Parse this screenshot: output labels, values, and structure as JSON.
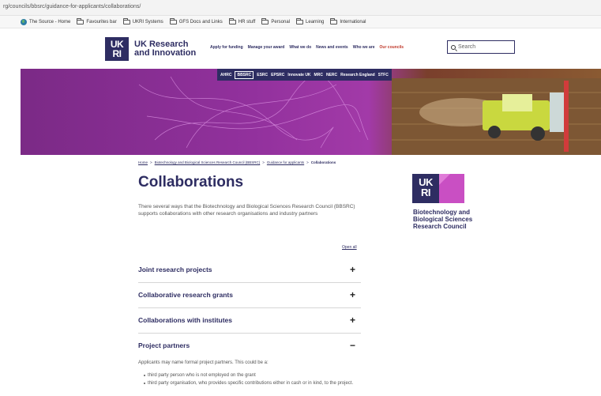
{
  "browser": {
    "url": "rg/councils/bbsrc/guidance-for-applicants/collaborations/",
    "bookmarks": [
      {
        "label": "The Source - Home",
        "icon": "globe-icon"
      },
      {
        "label": "Favourites bar",
        "icon": "folder-icon"
      },
      {
        "label": "UKRI Systems",
        "icon": "folder-icon"
      },
      {
        "label": "GFS Docs and Links",
        "icon": "folder-icon"
      },
      {
        "label": "HR stuff",
        "icon": "folder-icon"
      },
      {
        "label": "Personal",
        "icon": "folder-icon"
      },
      {
        "label": "Learning",
        "icon": "folder-icon"
      },
      {
        "label": "International",
        "icon": "folder-icon"
      }
    ]
  },
  "header": {
    "logo_line1": "UK",
    "logo_line2": "RI",
    "org_line1": "UK Research",
    "org_line2": "and Innovation",
    "nav": [
      "Apply for funding",
      "Manage your award",
      "What we do",
      "News and events",
      "Who we are",
      "Our councils"
    ],
    "active_nav": "Our councils",
    "search_placeholder": "Search"
  },
  "councils": [
    "AHRC",
    "BBSRC",
    "ESRC",
    "EPSRC",
    "Innovate UK",
    "MRC",
    "NERC",
    "Research England",
    "STFC"
  ],
  "active_council": "BBSRC",
  "breadcrumb": {
    "items": [
      "Home",
      "Biotechnology and Biological Sciences Research Council (BBSRC)",
      "Guidance for applicants"
    ],
    "current": "Collaborations",
    "separator": ">"
  },
  "page": {
    "title": "Collaborations",
    "intro": "There several ways that the Biotechnology and Biological Sciences Research Council (BBSRC) supports collaborations with other research organisations and industry partners"
  },
  "council_logo": {
    "line1": "UK",
    "line2": "RI",
    "name": "Biotechnology and Biological Sciences Research Council"
  },
  "accordion": {
    "open_all": "Open all",
    "items": [
      {
        "label": "Joint research projects",
        "toggle": "+"
      },
      {
        "label": "Collaborative research grants",
        "toggle": "+"
      },
      {
        "label": "Collaborations with institutes",
        "toggle": "+"
      },
      {
        "label": "Project partners",
        "toggle": "−"
      }
    ],
    "expanded_body": {
      "text": "Applicants may name formal project partners. This could be a:",
      "bullets": [
        "third party person who is not employed on the grant",
        "third party organisation, who provides specific contributions either in cash or in kind, to the project."
      ]
    }
  },
  "colors": {
    "brand": "#2e2d62",
    "active_nav": "#c0392b",
    "banner_purple": "#92319d",
    "bbsrc_pink": "#c94fc3"
  }
}
